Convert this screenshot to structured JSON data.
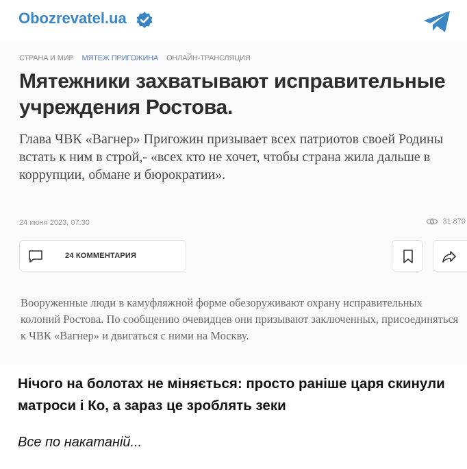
{
  "channel": {
    "name": "Obozrevatel.ua",
    "verified_icon": "verified-badge-icon",
    "share_icon": "telegram-paper-plane-icon",
    "accent_color": "#3a86c4"
  },
  "article": {
    "breadcrumb": [
      "СТРАНА И МИР",
      "МЯТЕЖ ПРИГОЖИНА",
      "ОНЛАЙН-ТРАНСЛЯЦИЯ"
    ],
    "headline": "Мятежники захватывают исправительные учреждения Ростова.",
    "lead": "Глава ЧВК «Вагнер» Пригожин призывает всех патриотов своей Родины встать к ним в строй,- «всех кто не хочет, чтобы страна жила дальше в коррупции, обмане и бюрократии».",
    "date": "24 июня 2023, 07:30",
    "views": "31 879",
    "comments_label": "24 КОММЕНТАРИЯ",
    "body": "Вооруженные люди в камуфляжной форме обезоруживают охрану исправительных колоний Ростова. По сообщению очевидцев они призывают заключенных, присоединяться к ЧВК «Вагнер» и двигаться с ними на Москву."
  },
  "post": {
    "text": "Нічого на болотах не міняється: просто раніше царя скинули матроси і Ко, а зараз це зроблять зеки",
    "signature": "Все по накатаній..."
  }
}
